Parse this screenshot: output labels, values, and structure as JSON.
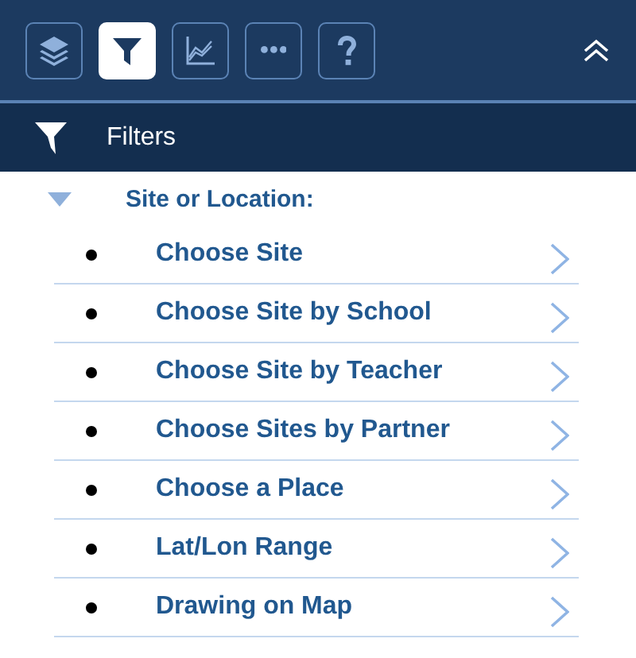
{
  "toolbar": {
    "buttons": [
      {
        "kind": "layers",
        "selected": false
      },
      {
        "kind": "filter",
        "selected": true
      },
      {
        "kind": "chart",
        "selected": false
      },
      {
        "kind": "more",
        "selected": false
      },
      {
        "kind": "help",
        "selected": false
      }
    ]
  },
  "panel": {
    "title": "Filters"
  },
  "section": {
    "title": "Site or Location:",
    "expanded": true,
    "items": [
      {
        "label": "Choose Site"
      },
      {
        "label": "Choose Site by School"
      },
      {
        "label": "Choose Site by Teacher"
      },
      {
        "label": "Choose Sites by Partner"
      },
      {
        "label": "Choose a Place"
      },
      {
        "label": "Lat/Lon Range"
      },
      {
        "label": "Drawing on Map"
      }
    ]
  }
}
